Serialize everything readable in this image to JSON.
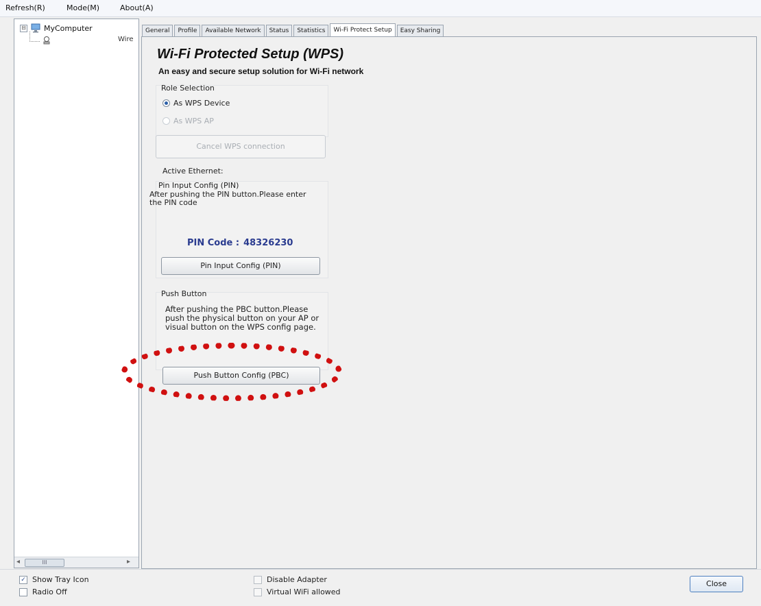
{
  "menu": {
    "refresh": "Refresh(R)",
    "mode": "Mode(M)",
    "about": "About(A)"
  },
  "tree": {
    "expander": "⊟",
    "root_label": "MyComputer",
    "child_label": "Wire",
    "scroll_thumb": "III"
  },
  "tabs": [
    {
      "label": "General"
    },
    {
      "label": "Profile"
    },
    {
      "label": "Available Network"
    },
    {
      "label": "Status"
    },
    {
      "label": "Statistics"
    },
    {
      "label": "Wi-Fi Protect Setup",
      "active": true
    },
    {
      "label": "Easy Sharing"
    }
  ],
  "wps": {
    "title": "Wi-Fi Protected Setup (WPS)",
    "subtitle": "An easy and secure setup solution for Wi-Fi network",
    "role_title": "Role Selection",
    "role_device": "As WPS Device",
    "role_ap": "As WPS AP",
    "cancel_label": "Cancel WPS connection",
    "active_ethernet": "Active Ethernet:",
    "pin_heading": "Pin Input Config (PIN)",
    "pin_desc": "After pushing the PIN button.Please enter the PIN code",
    "pin_code_label": "PIN Code :",
    "pin_code_value": "48326230",
    "pin_button": "Pin Input Config (PIN)",
    "push_title": "Push Button",
    "push_desc": "After pushing the PBC button.Please push the physical button on your AP or visual button on the WPS config page.",
    "pbc_button": "Push Button Config (PBC)",
    "highlight_color": "#d01010"
  },
  "bottom": {
    "show_tray_icon": "Show Tray Icon",
    "radio_off": "Radio Off",
    "disable_adapter": "Disable Adapter",
    "virtual_wifi": "Virtual WiFi allowed",
    "close": "Close"
  }
}
